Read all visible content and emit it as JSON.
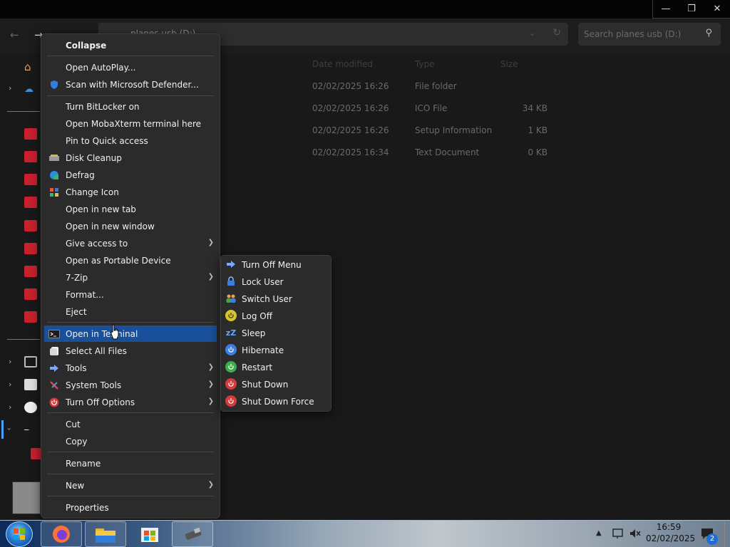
{
  "window": {
    "controls": [
      "minimize",
      "restore",
      "close"
    ]
  },
  "address": {
    "path": "planes usb (D:)",
    "search_placeholder": "Search planes usb (D:)"
  },
  "columns": {
    "date": "Date modified",
    "type": "Type",
    "size": "Size"
  },
  "files": [
    {
      "date": "02/02/2025 16:26",
      "type": "File folder",
      "size": ""
    },
    {
      "date": "02/02/2025 16:26",
      "type": "ICO File",
      "size": "34 KB"
    },
    {
      "date": "02/02/2025 16:26",
      "type": "Setup Information",
      "size": "1 KB"
    },
    {
      "date": "02/02/2025 16:34",
      "type": "Text Document",
      "size": "0 KB"
    }
  ],
  "context_menu": {
    "collapse": "Collapse",
    "open_autoplay": "Open AutoPlay...",
    "scan_defender": "Scan with Microsoft Defender...",
    "bitlocker": "Turn BitLocker on",
    "mobaxterm": "Open MobaXterm terminal here",
    "pin_quick": "Pin to Quick access",
    "disk_cleanup": "Disk Cleanup",
    "defrag": "Defrag",
    "change_icon": "Change Icon",
    "new_tab": "Open in new tab",
    "new_window": "Open in new window",
    "give_access": "Give access to",
    "portable": "Open as Portable Device",
    "seven_zip": "7-Zip",
    "format": "Format...",
    "eject": "Eject",
    "terminal": "Open in Terminal",
    "select_all": "Select All Files",
    "tools": "Tools",
    "system_tools": "System Tools",
    "turn_off": "Turn Off Options",
    "cut": "Cut",
    "copy": "Copy",
    "rename": "Rename",
    "new": "New",
    "properties": "Properties"
  },
  "submenu": {
    "turn_off_menu": "Turn Off Menu",
    "lock_user": "Lock User",
    "switch_user": "Switch User",
    "log_off": "Log Off",
    "sleep": "Sleep",
    "hibernate": "Hibernate",
    "restart": "Restart",
    "shut_down": "Shut Down",
    "shut_down_force": "Shut Down Force"
  },
  "taskbar": {
    "time": "16:59",
    "date": "02/02/2025",
    "notifications": "2"
  },
  "colors": {
    "highlight": "#1a4f99",
    "menu_bg": "#2b2b2b",
    "content_bg": "#191919",
    "accent_red": "#c8202d"
  }
}
